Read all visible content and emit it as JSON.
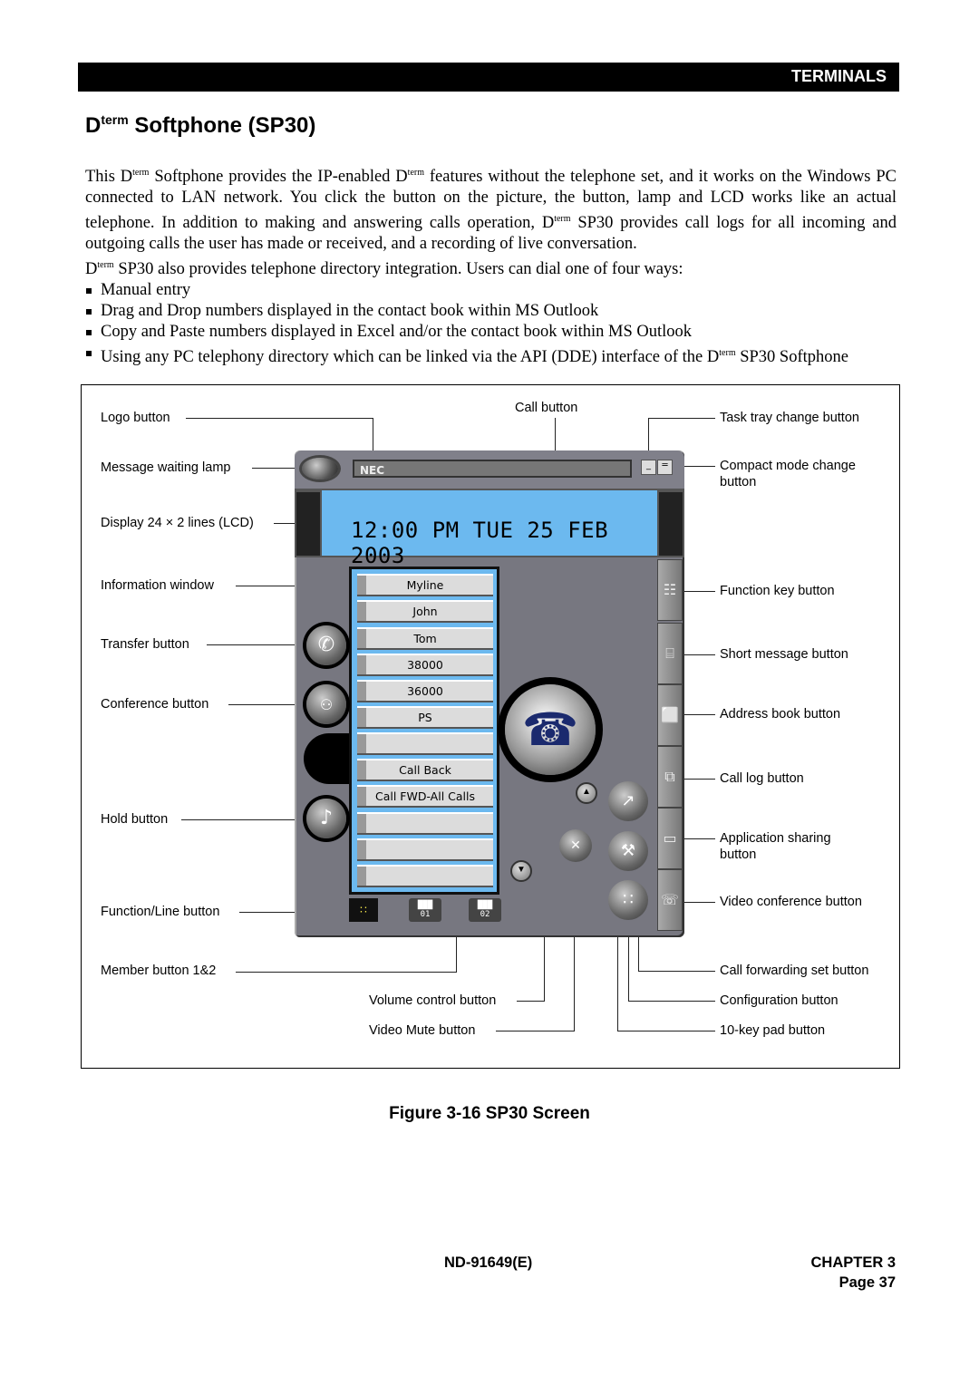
{
  "header": {
    "section": "TERMINALS"
  },
  "title": {
    "prefix": "D",
    "sup": "term",
    "rest": " Softphone (SP30)"
  },
  "body": {
    "para1": [
      {
        "t": "This D"
      },
      {
        "sup": "term"
      },
      {
        "t": " Softphone provides the IP-enabled D"
      },
      {
        "sup": "term"
      },
      {
        "t": " features without the telephone set, and it works on the Windows PC connected to LAN network.  You click the button on the picture, the button, lamp and LCD works like an actual telephone.  In addition to making and answering calls operation, D"
      },
      {
        "sup": "term"
      },
      {
        "t": " SP30 provides call logs for all incoming and outgoing calls the user has made or received, and a recording of live conversation."
      }
    ],
    "para2": [
      {
        "t": "D"
      },
      {
        "sup": "term"
      },
      {
        "t": " SP30 also provides telephone directory integration.  Users can dial one of four ways:"
      }
    ],
    "bullets": [
      "Manual entry",
      "Drag and Drop numbers displayed in the contact book within MS Outlook",
      "Copy and Paste numbers displayed in Excel and/or the contact book within MS Outlook"
    ],
    "bullet4": [
      {
        "t": "Using any PC telephony directory which can be linked via the API (DDE) interface of the D"
      },
      {
        "sup": "term"
      },
      {
        "t": " SP30 Softphone"
      }
    ]
  },
  "figure": {
    "callouts": {
      "logo": "Logo button",
      "lamp": "Message waiting lamp",
      "display": "Display 24 × 2 lines (LCD)",
      "info": "Information window",
      "transfer": "Transfer button",
      "conference": "Conference button",
      "hold": "Hold button",
      "function_line": "Function/Line button",
      "member": "Member button 1&2",
      "call": "Call button",
      "volume": "Volume control button",
      "video_mute": "Video Mute button",
      "task_tray": "Task tray change button",
      "compact_1": "Compact mode change",
      "compact_2": "button",
      "function_key": "Function key button",
      "short_message": "Short message button",
      "address_book": "Address book button",
      "call_log": "Call log button",
      "app_sharing_1": "Application sharing",
      "app_sharing_2": "button",
      "video_conf": "Video conference button",
      "call_fwd": "Call forwarding set button",
      "config": "Configuration button",
      "keypad": "10-key pad button"
    },
    "phone": {
      "logo": "NEC",
      "lcd": "12:00 PM TUE 25 FEB 2003",
      "keys": [
        "Myline",
        "John",
        "Tom",
        "38000",
        "36000",
        "PS",
        "",
        "Call Back",
        "Call FWD-All Calls",
        "",
        "",
        ""
      ],
      "member1": "01",
      "member2": "02"
    },
    "caption": "Figure 3-16  SP30 Screen"
  },
  "footer": {
    "doc": "ND-91649(E)",
    "chapter": "CHAPTER 3",
    "page": "Page 37"
  }
}
